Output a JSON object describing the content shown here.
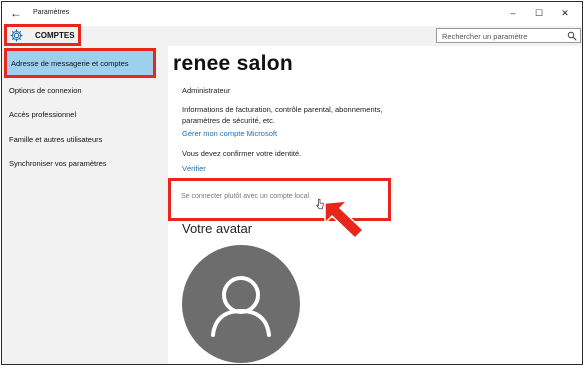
{
  "window": {
    "app_title": "Paramètres",
    "back_glyph": "←",
    "minimize_glyph": "–",
    "maximize_glyph": "☐",
    "close_glyph": "✕"
  },
  "header": {
    "section_title": "COMPTES",
    "icon": "gear-icon",
    "search_placeholder": "Rechercher un paramètre"
  },
  "sidebar": {
    "items": [
      {
        "label": "Adresse de messagerie et comptes",
        "active": true
      },
      {
        "label": "Options de connexion",
        "active": false
      },
      {
        "label": "Accès professionnel",
        "active": false
      },
      {
        "label": "Famille et autres utilisateurs",
        "active": false
      },
      {
        "label": "Synchroniser vos paramètres",
        "active": false
      }
    ]
  },
  "main": {
    "user_name": "renee salon",
    "role": "Administrateur",
    "billing_info": "Informations de facturation, contrôle parental, abonnements, paramètres de sécurité, etc.",
    "manage_link": "Gérer mon compte Microsoft",
    "confirm_text": "Vous devez confirmer votre identité.",
    "verify_link": "Vérifier",
    "local_account_link": "Se connecter plutôt avec un compte local",
    "avatar_title": "Votre avatar"
  },
  "colors": {
    "highlight_red": "#e8261c",
    "sidebar_active": "#9dd0ec",
    "link_blue": "#1a6fb5",
    "avatar_gray": "#6d6d6d"
  }
}
